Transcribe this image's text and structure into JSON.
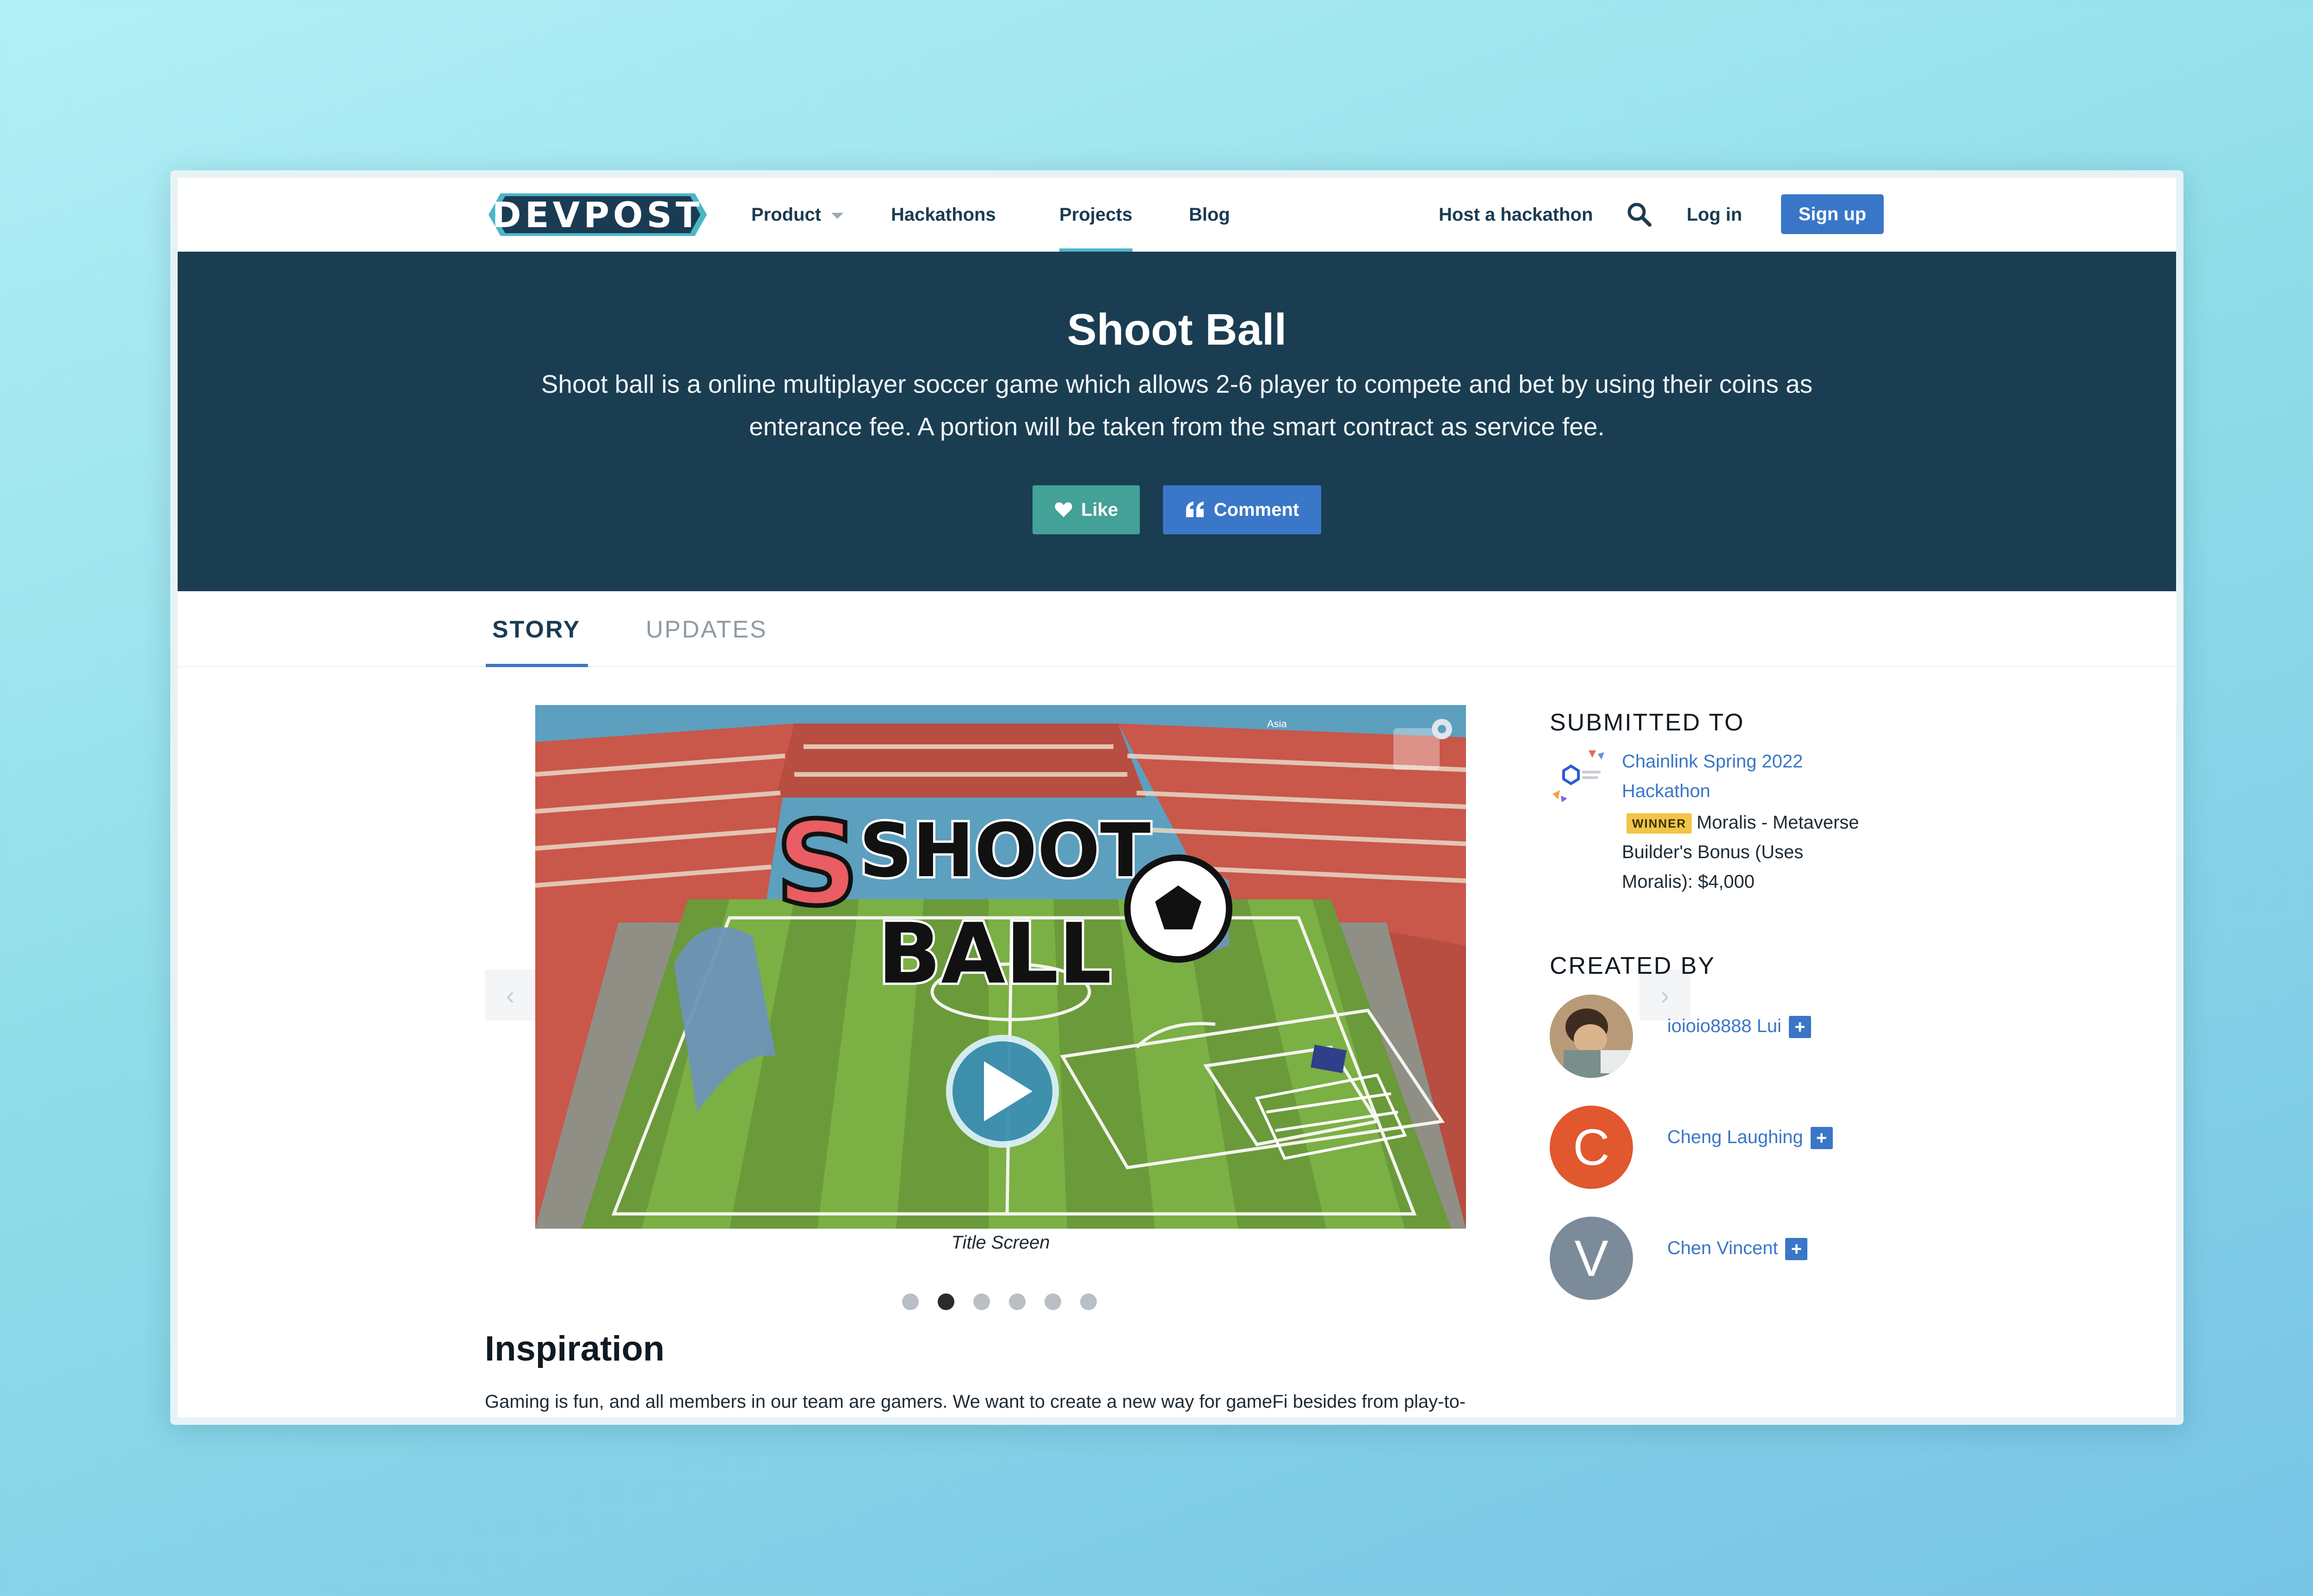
{
  "nav": {
    "logo": "DEVPOST",
    "product": "Product",
    "hackathons": "Hackathons",
    "projects": "Projects",
    "blog": "Blog",
    "host": "Host a hackathon",
    "login": "Log in",
    "signup": "Sign up"
  },
  "hero": {
    "title": "Shoot Ball",
    "tagline": "Shoot ball is a online multiplayer soccer game which allows 2-6 player to compete and bet by using their coins as enterance fee. A portion will be taken from the smart contract as service fee.",
    "like": "Like",
    "comment": "Comment"
  },
  "tabs": {
    "story": "STORY",
    "updates": "UPDATES"
  },
  "gallery": {
    "caption": "Title Screen",
    "game_logo_line1": "SHOOT",
    "game_logo_line2": "BALL",
    "overlay_region": "Asia",
    "slides": 6,
    "active_slide": 2
  },
  "story": {
    "heading": "Inspiration",
    "text": "Gaming is fun, and all members in our team are gamers. We want to create a new way for gameFi besides from play-to-"
  },
  "sidebar": {
    "submitted_heading": "SUBMITTED TO",
    "hackathon": "Chainlink Spring 2022 Hackathon",
    "winner_badge": "WINNER",
    "prize": "Moralis - Metaverse Builder's Bonus (Uses Moralis): $4,000",
    "created_heading": "CREATED BY",
    "members": [
      {
        "name": "ioioio8888 Lui",
        "initial": ""
      },
      {
        "name": "Cheng Laughing",
        "initial": "C"
      },
      {
        "name": "Chen Vincent",
        "initial": "V"
      }
    ]
  },
  "colors": {
    "hero_bg": "#1a3d52",
    "accent_blue": "#3a76c7",
    "like_green": "#44a198",
    "winner_gold": "#f1c547",
    "avatar_orange": "#e1572e",
    "avatar_gray": "#7c8b99"
  }
}
